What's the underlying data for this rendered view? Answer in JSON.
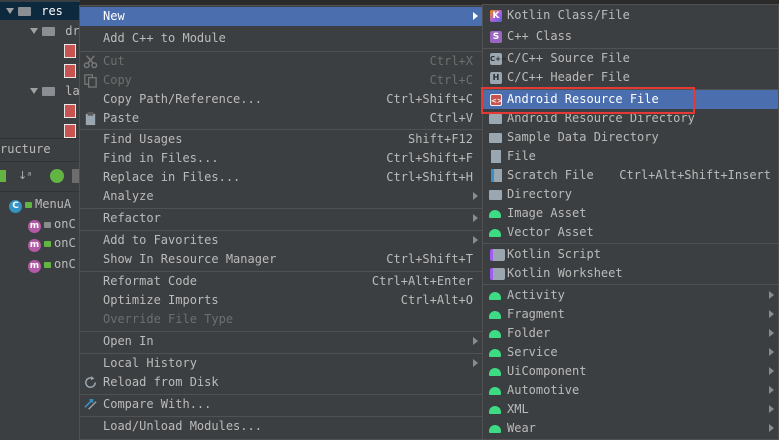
{
  "background": {
    "tree": {
      "root_label": "res",
      "row2_label": "dr",
      "row5_label": "la"
    },
    "structure_panel": {
      "title": "ructure",
      "class_label": "MenuA",
      "methods": [
        "onC",
        "onC",
        "onC"
      ]
    }
  },
  "context_menu": {
    "items": [
      {
        "label": "New",
        "shortcut": "",
        "submenu": true,
        "highlighted": true
      },
      {
        "label": "Add C++ to Module",
        "shortcut": ""
      },
      {
        "label": "Cut",
        "shortcut": "Ctrl+X",
        "disabled": true,
        "icon": "scissors-icon"
      },
      {
        "label": "Copy",
        "shortcut": "Ctrl+C",
        "disabled": true,
        "icon": "copy-icon"
      },
      {
        "label": "Copy Path/Reference...",
        "shortcut": "Ctrl+Shift+C"
      },
      {
        "label": "Paste",
        "shortcut": "Ctrl+V",
        "icon": "clipboard-icon"
      },
      {
        "label": "Find Usages",
        "shortcut": "Shift+F12"
      },
      {
        "label": "Find in Files...",
        "shortcut": "Ctrl+Shift+F"
      },
      {
        "label": "Replace in Files...",
        "shortcut": "Ctrl+Shift+H"
      },
      {
        "label": "Analyze",
        "shortcut": "",
        "submenu": true
      },
      {
        "label": "Refactor",
        "shortcut": "",
        "submenu": true
      },
      {
        "label": "Add to Favorites",
        "shortcut": "",
        "submenu": true
      },
      {
        "label": "Show In Resource Manager",
        "shortcut": "Ctrl+Shift+T"
      },
      {
        "label": "Reformat Code",
        "shortcut": "Ctrl+Alt+Enter"
      },
      {
        "label": "Optimize Imports",
        "shortcut": "Ctrl+Alt+O"
      },
      {
        "label": "Override File Type",
        "shortcut": "",
        "disabled": true
      },
      {
        "label": "Open In",
        "shortcut": "",
        "submenu": true
      },
      {
        "label": "Local History",
        "shortcut": "",
        "submenu": true
      },
      {
        "label": "Reload from Disk",
        "shortcut": "",
        "icon": "reload-icon"
      },
      {
        "label": "Compare With...",
        "shortcut": "",
        "icon": "compare-icon"
      },
      {
        "label": "Load/Unload Modules...",
        "shortcut": ""
      }
    ]
  },
  "new_submenu": {
    "items": [
      {
        "label": "Kotlin Class/File",
        "icon": "kotlin-icon"
      },
      {
        "label": "C++ Class",
        "icon": "cpp-class-icon"
      },
      {
        "label": "C/C++ Source File",
        "icon": "cpp-source-icon"
      },
      {
        "label": "C/C++ Header File",
        "icon": "cpp-header-icon"
      },
      {
        "label": "Android Resource File",
        "icon": "xml-file-icon",
        "highlighted": true
      },
      {
        "label": "Android Resource Directory",
        "icon": "folder-icon"
      },
      {
        "label": "Sample Data Directory",
        "icon": "folder-icon"
      },
      {
        "label": "File",
        "icon": "file-icon"
      },
      {
        "label": "Scratch File",
        "shortcut": "Ctrl+Alt+Shift+Insert",
        "icon": "scratch-icon"
      },
      {
        "label": "Directory",
        "icon": "folder-icon"
      },
      {
        "label": "Image Asset",
        "icon": "android-icon"
      },
      {
        "label": "Vector Asset",
        "icon": "android-icon"
      },
      {
        "label": "Kotlin Script",
        "icon": "kotlin-script-icon"
      },
      {
        "label": "Kotlin Worksheet",
        "icon": "kotlin-worksheet-icon"
      },
      {
        "label": "Activity",
        "icon": "android-icon",
        "submenu": true
      },
      {
        "label": "Fragment",
        "icon": "android-icon",
        "submenu": true
      },
      {
        "label": "Folder",
        "icon": "android-icon",
        "submenu": true
      },
      {
        "label": "Service",
        "icon": "android-icon",
        "submenu": true
      },
      {
        "label": "UiComponent",
        "icon": "android-icon",
        "submenu": true
      },
      {
        "label": "Automotive",
        "icon": "android-icon",
        "submenu": true
      },
      {
        "label": "XML",
        "icon": "android-icon",
        "submenu": true
      },
      {
        "label": "Wear",
        "icon": "android-icon",
        "submenu": true
      }
    ]
  },
  "colors": {
    "menu_bg": "#3c3f41",
    "highlight": "#4b6eaf",
    "annotation_box": "#e53935",
    "android_green": "#3ddc84"
  }
}
